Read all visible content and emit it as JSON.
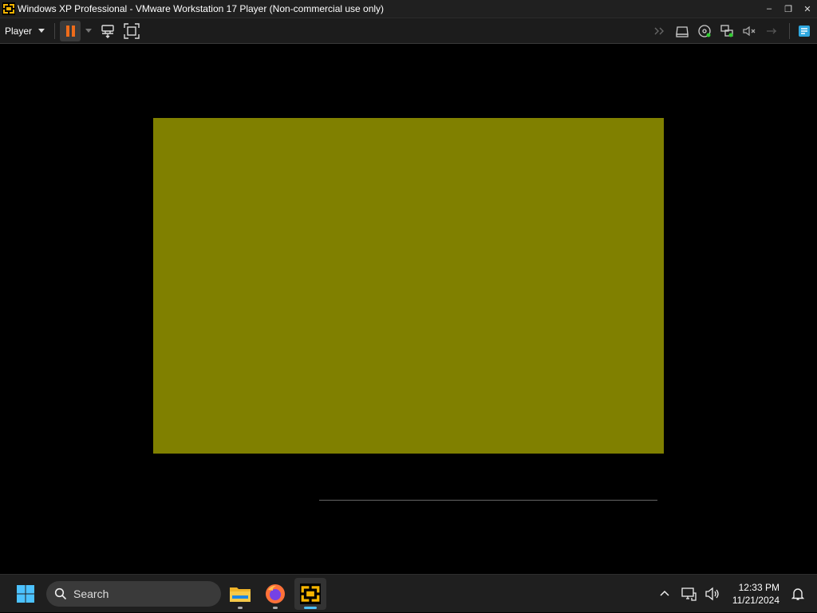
{
  "window": {
    "title": "Windows XP Professional - VMware Workstation 17 Player (Non-commercial use only)",
    "controls": {
      "minimize": "–",
      "restore": "❐",
      "close": "✕"
    }
  },
  "toolbar": {
    "player_menu_label": "Player",
    "left_icons": [
      "pause-icon",
      "send-ctrl-alt-del-icon",
      "fullscreen-icon"
    ],
    "right_icons": [
      "forward-icon",
      "removable-device-icon",
      "cd-dvd-icon",
      "network-adapter-icon",
      "sound-card-icon",
      "usb-icon",
      "unity-icon"
    ],
    "accent": "#ef6c1a"
  },
  "vm": {
    "screen_color": "#808000",
    "screen_content": ""
  },
  "taskbar": {
    "search_placeholder": "Search",
    "apps": [
      {
        "name": "File Explorer",
        "icon": "folder-icon",
        "active": false
      },
      {
        "name": "Firefox",
        "icon": "firefox-icon",
        "active": false
      },
      {
        "name": "VMware Workstation Player",
        "icon": "vmware-icon",
        "active": true
      }
    ],
    "tray_icons": [
      "chevron-up-icon",
      "network-icon",
      "volume-icon"
    ],
    "time": "12:33 PM",
    "date": "11/21/2024",
    "accent": "#4cc2ff"
  }
}
